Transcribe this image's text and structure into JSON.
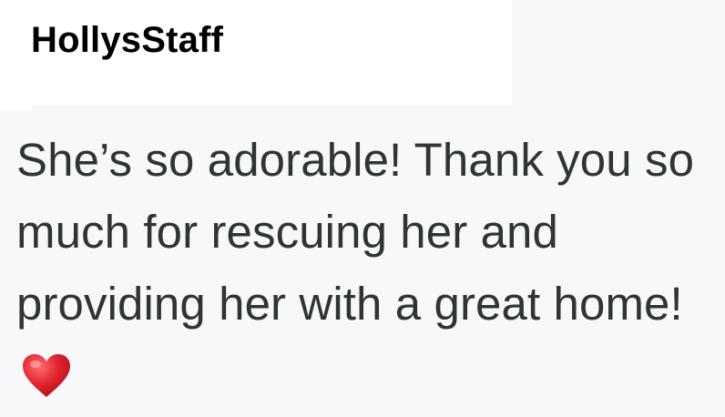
{
  "comment": {
    "username": "HollysStaff",
    "text": "She’s so adorable! Thank you so much for rescuing her and providing her with a great home!",
    "emoji": "heart-icon",
    "colors": {
      "background": "#f7f8fa",
      "header_background": "#ffffff",
      "username": "#000000",
      "text": "#2f3437",
      "heart": "#e0222b"
    }
  }
}
